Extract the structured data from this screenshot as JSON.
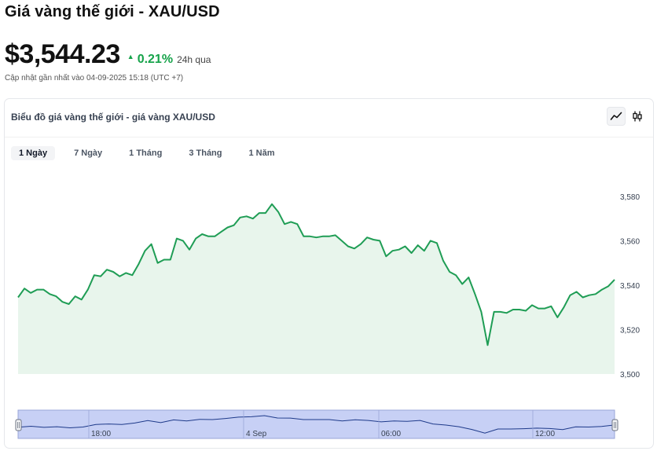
{
  "header": {
    "title": "Giá vàng thế giới - XAU/USD",
    "price": "$3,544.23",
    "change_arrow": "▲",
    "change_pct": "0.21%",
    "change_period": "24h qua",
    "updated": "Cập nhật gần nhất vào 04-09-2025 15:18 (UTC +7)"
  },
  "card": {
    "title": "Biểu đồ giá vàng thế giới - giá vàng XAU/USD",
    "chart_type_line_icon": "line-chart-icon",
    "chart_type_candle_icon": "candlestick-icon"
  },
  "tabs": [
    {
      "label": "1 Ngày",
      "active": true
    },
    {
      "label": "7 Ngày",
      "active": false
    },
    {
      "label": "1 Tháng",
      "active": false
    },
    {
      "label": "3 Tháng",
      "active": false
    },
    {
      "label": "1 Năm",
      "active": false
    }
  ],
  "colors": {
    "line": "#1f9d55",
    "area": "#e8f5ec",
    "up": "#16a34a",
    "navigator_fill": "#c7d0f5",
    "navigator_line": "#1e3a8a"
  },
  "chart_data": {
    "type": "area",
    "y_ticks": [
      "3,500",
      "3,520",
      "3,540",
      "3,560",
      "3,580"
    ],
    "ylim": [
      3500,
      3592
    ],
    "navigator_labels": [
      "18:00",
      "4 Sep",
      "06:00",
      "12:00"
    ],
    "values": [
      3534.5,
      3538.5,
      3536.5,
      3538,
      3538,
      3536,
      3535,
      3532.5,
      3531.5,
      3535,
      3533.5,
      3538,
      3544.5,
      3544,
      3547,
      3546,
      3544,
      3545.5,
      3544.5,
      3549.5,
      3555.5,
      3558.5,
      3550,
      3551.5,
      3551.5,
      3561,
      3560,
      3556,
      3561,
      3563,
      3562,
      3562,
      3564,
      3566,
      3567,
      3570.5,
      3571,
      3570,
      3572.5,
      3572.5,
      3576.5,
      3573,
      3567.5,
      3568.5,
      3567.5,
      3562,
      3562,
      3561.5,
      3562,
      3562,
      3562.5,
      3560,
      3557.5,
      3556.5,
      3558.5,
      3561.5,
      3560.5,
      3560,
      3553,
      3555.5,
      3556,
      3557.5,
      3554.5,
      3558,
      3555.5,
      3560,
      3559,
      3551,
      3546,
      3544.5,
      3540.5,
      3543.5,
      3536,
      3528,
      3513,
      3528,
      3528,
      3527.5,
      3529,
      3529,
      3528.5,
      3531,
      3529.5,
      3529.5,
      3530.5,
      3525.5,
      3530,
      3535.5,
      3537,
      3534.5,
      3535.5,
      3536,
      3538,
      3539.5,
      3542.5
    ],
    "nav_values": [
      3534.5,
      3538,
      3534,
      3536,
      3532,
      3535,
      3544.5,
      3546,
      3544.5,
      3549.5,
      3558.5,
      3551,
      3561,
      3557,
      3563,
      3562,
      3566,
      3571,
      3572.5,
      3576.5,
      3568,
      3567.5,
      3562,
      3562,
      3562,
      3557,
      3561.5,
      3559,
      3554,
      3557,
      3555.5,
      3559,
      3546,
      3542,
      3536,
      3526,
      3513,
      3528,
      3528,
      3529,
      3531,
      3529.5,
      3525.5,
      3535.5,
      3535,
      3537,
      3542.5
    ]
  }
}
